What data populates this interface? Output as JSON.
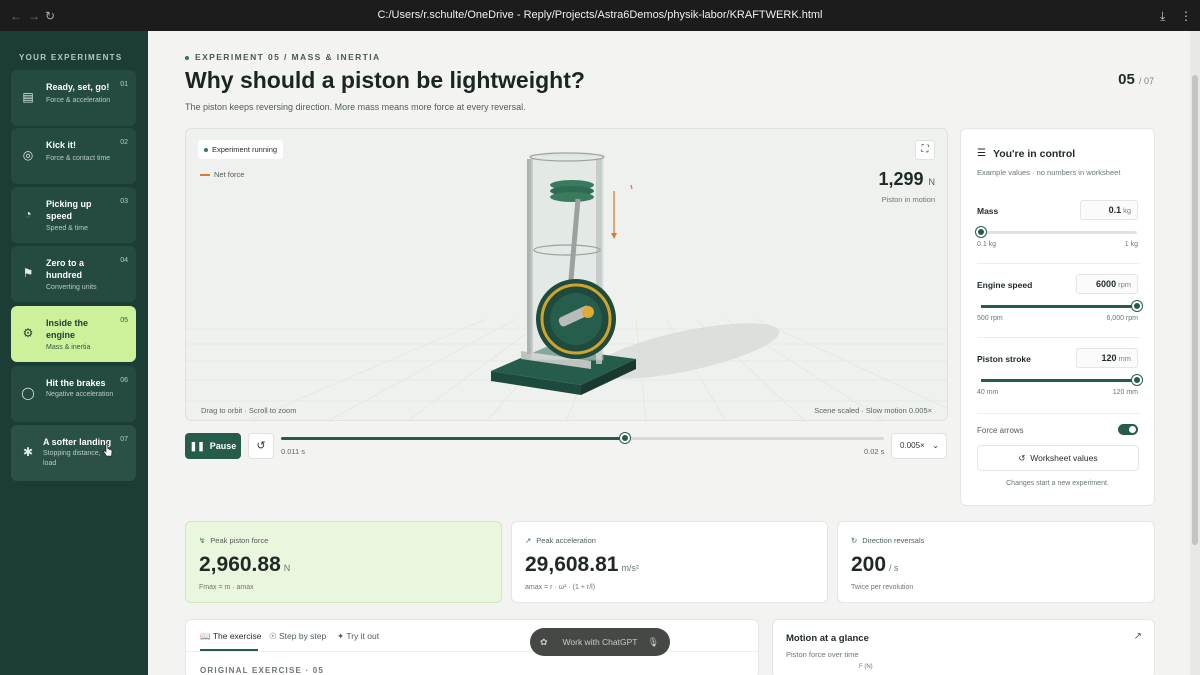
{
  "browser": {
    "url": "C:/Users/r.schulte/OneDrive - Reply/Projects/Astra6Demos/physik-labor/KRAFTWERK.html",
    "back_icon": "arrow-left-icon",
    "forward_icon": "arrow-right-icon",
    "reload_icon": "reload-icon",
    "download_icon": "download-icon",
    "menu_icon": "more-icon"
  },
  "sidebar": {
    "heading": "YOUR EXPERIMENTS",
    "items": [
      {
        "title": "Ready, set, go!",
        "subtitle": "Force & acceleration",
        "number": "01",
        "icon": "car-icon"
      },
      {
        "title": "Kick it!",
        "subtitle": "Force & contact time",
        "number": "02",
        "icon": "target-icon"
      },
      {
        "title": "Picking up speed",
        "subtitle": "Speed & time",
        "number": "03",
        "icon": "gauge-icon"
      },
      {
        "title": "Zero to a hundred",
        "subtitle": "Converting units",
        "number": "04",
        "icon": "flag-icon"
      },
      {
        "title": "Inside the engine",
        "subtitle": "Mass & inertia",
        "number": "05",
        "icon": "gear-icon"
      },
      {
        "title": "Hit the brakes",
        "subtitle": "Negative acceleration",
        "number": "06",
        "icon": "circle-icon"
      },
      {
        "title": "A softer landing",
        "subtitle": "Stopping distance, load",
        "number": "07",
        "icon": "person-icon"
      }
    ]
  },
  "header": {
    "breadcrumb": "EXPERIMENT 05  /  MASS & INERTIA",
    "title": "Why should a piston be lightweight?",
    "subtitle": "The piston keeps reversing direction. More mass means more force at every reversal.",
    "page_current": "05",
    "page_total": "/ 07"
  },
  "viewer": {
    "status": "Experiment running",
    "legend": "Net force",
    "force_value": "1,299",
    "force_unit": "N",
    "force_caption": "Piston in motion",
    "hint_left": "Drag to orbit · Scroll to zoom",
    "hint_right": "Scene scaled · Slow motion 0.005×",
    "fullscreen_icon": "fullscreen-icon"
  },
  "timeline": {
    "pause_label": "Pause",
    "pause_icon": "pause-icon",
    "reset_icon": "reset-icon",
    "time_current": "0.011 s",
    "time_end": "0.02 s",
    "progress": 0.57,
    "speed": "0.005×"
  },
  "control": {
    "title": "You're in control",
    "subtitle": "Example values · no numbers in worksheet",
    "sliders": [
      {
        "label": "Mass",
        "value": "0.1",
        "unit": "kg",
        "min": "0.1 kg",
        "max": "1 kg",
        "fraction": 0.0
      },
      {
        "label": "Engine speed",
        "value": "6000",
        "unit": "rpm",
        "min": "500 rpm",
        "max": "6,000 rpm",
        "fraction": 1.0
      },
      {
        "label": "Piston stroke",
        "value": "120",
        "unit": "mm",
        "min": "40 mm",
        "max": "120 mm",
        "fraction": 1.0
      }
    ],
    "toggle_label": "Force arrows",
    "toggle_on": true,
    "worksheet_button": "Worksheet values",
    "footer": "Changes start a new experiment."
  },
  "metrics": [
    {
      "label": "Peak piston force",
      "value": "2,960.88",
      "unit": "N",
      "formula": "Fmax = m · amax",
      "icon": "bolt-icon"
    },
    {
      "label": "Peak acceleration",
      "value": "29,608.81",
      "unit": "m/s²",
      "formula": "amax = r · ω² · (1 + r/l)",
      "icon": "arrow-up-right-icon"
    },
    {
      "label": "Direction reversals",
      "value": "200",
      "unit": "/ s",
      "formula": "Twice per revolution",
      "icon": "rotate-icon"
    }
  ],
  "exercise": {
    "tabs": [
      "The exercise",
      "Step by step",
      "Try it out"
    ],
    "heading": "ORIGINAL EXERCISE · 05"
  },
  "chat": {
    "label": "Work with ChatGPT"
  },
  "motion": {
    "title": "Motion at a glance",
    "subtitle": "Piston force over time",
    "axis_label": "F (N)"
  },
  "colors": {
    "sidebar_bg": "#1c3d36",
    "active_item": "#cdf09a",
    "accent": "#265c4c",
    "force_arrow": "#e07a2e"
  }
}
